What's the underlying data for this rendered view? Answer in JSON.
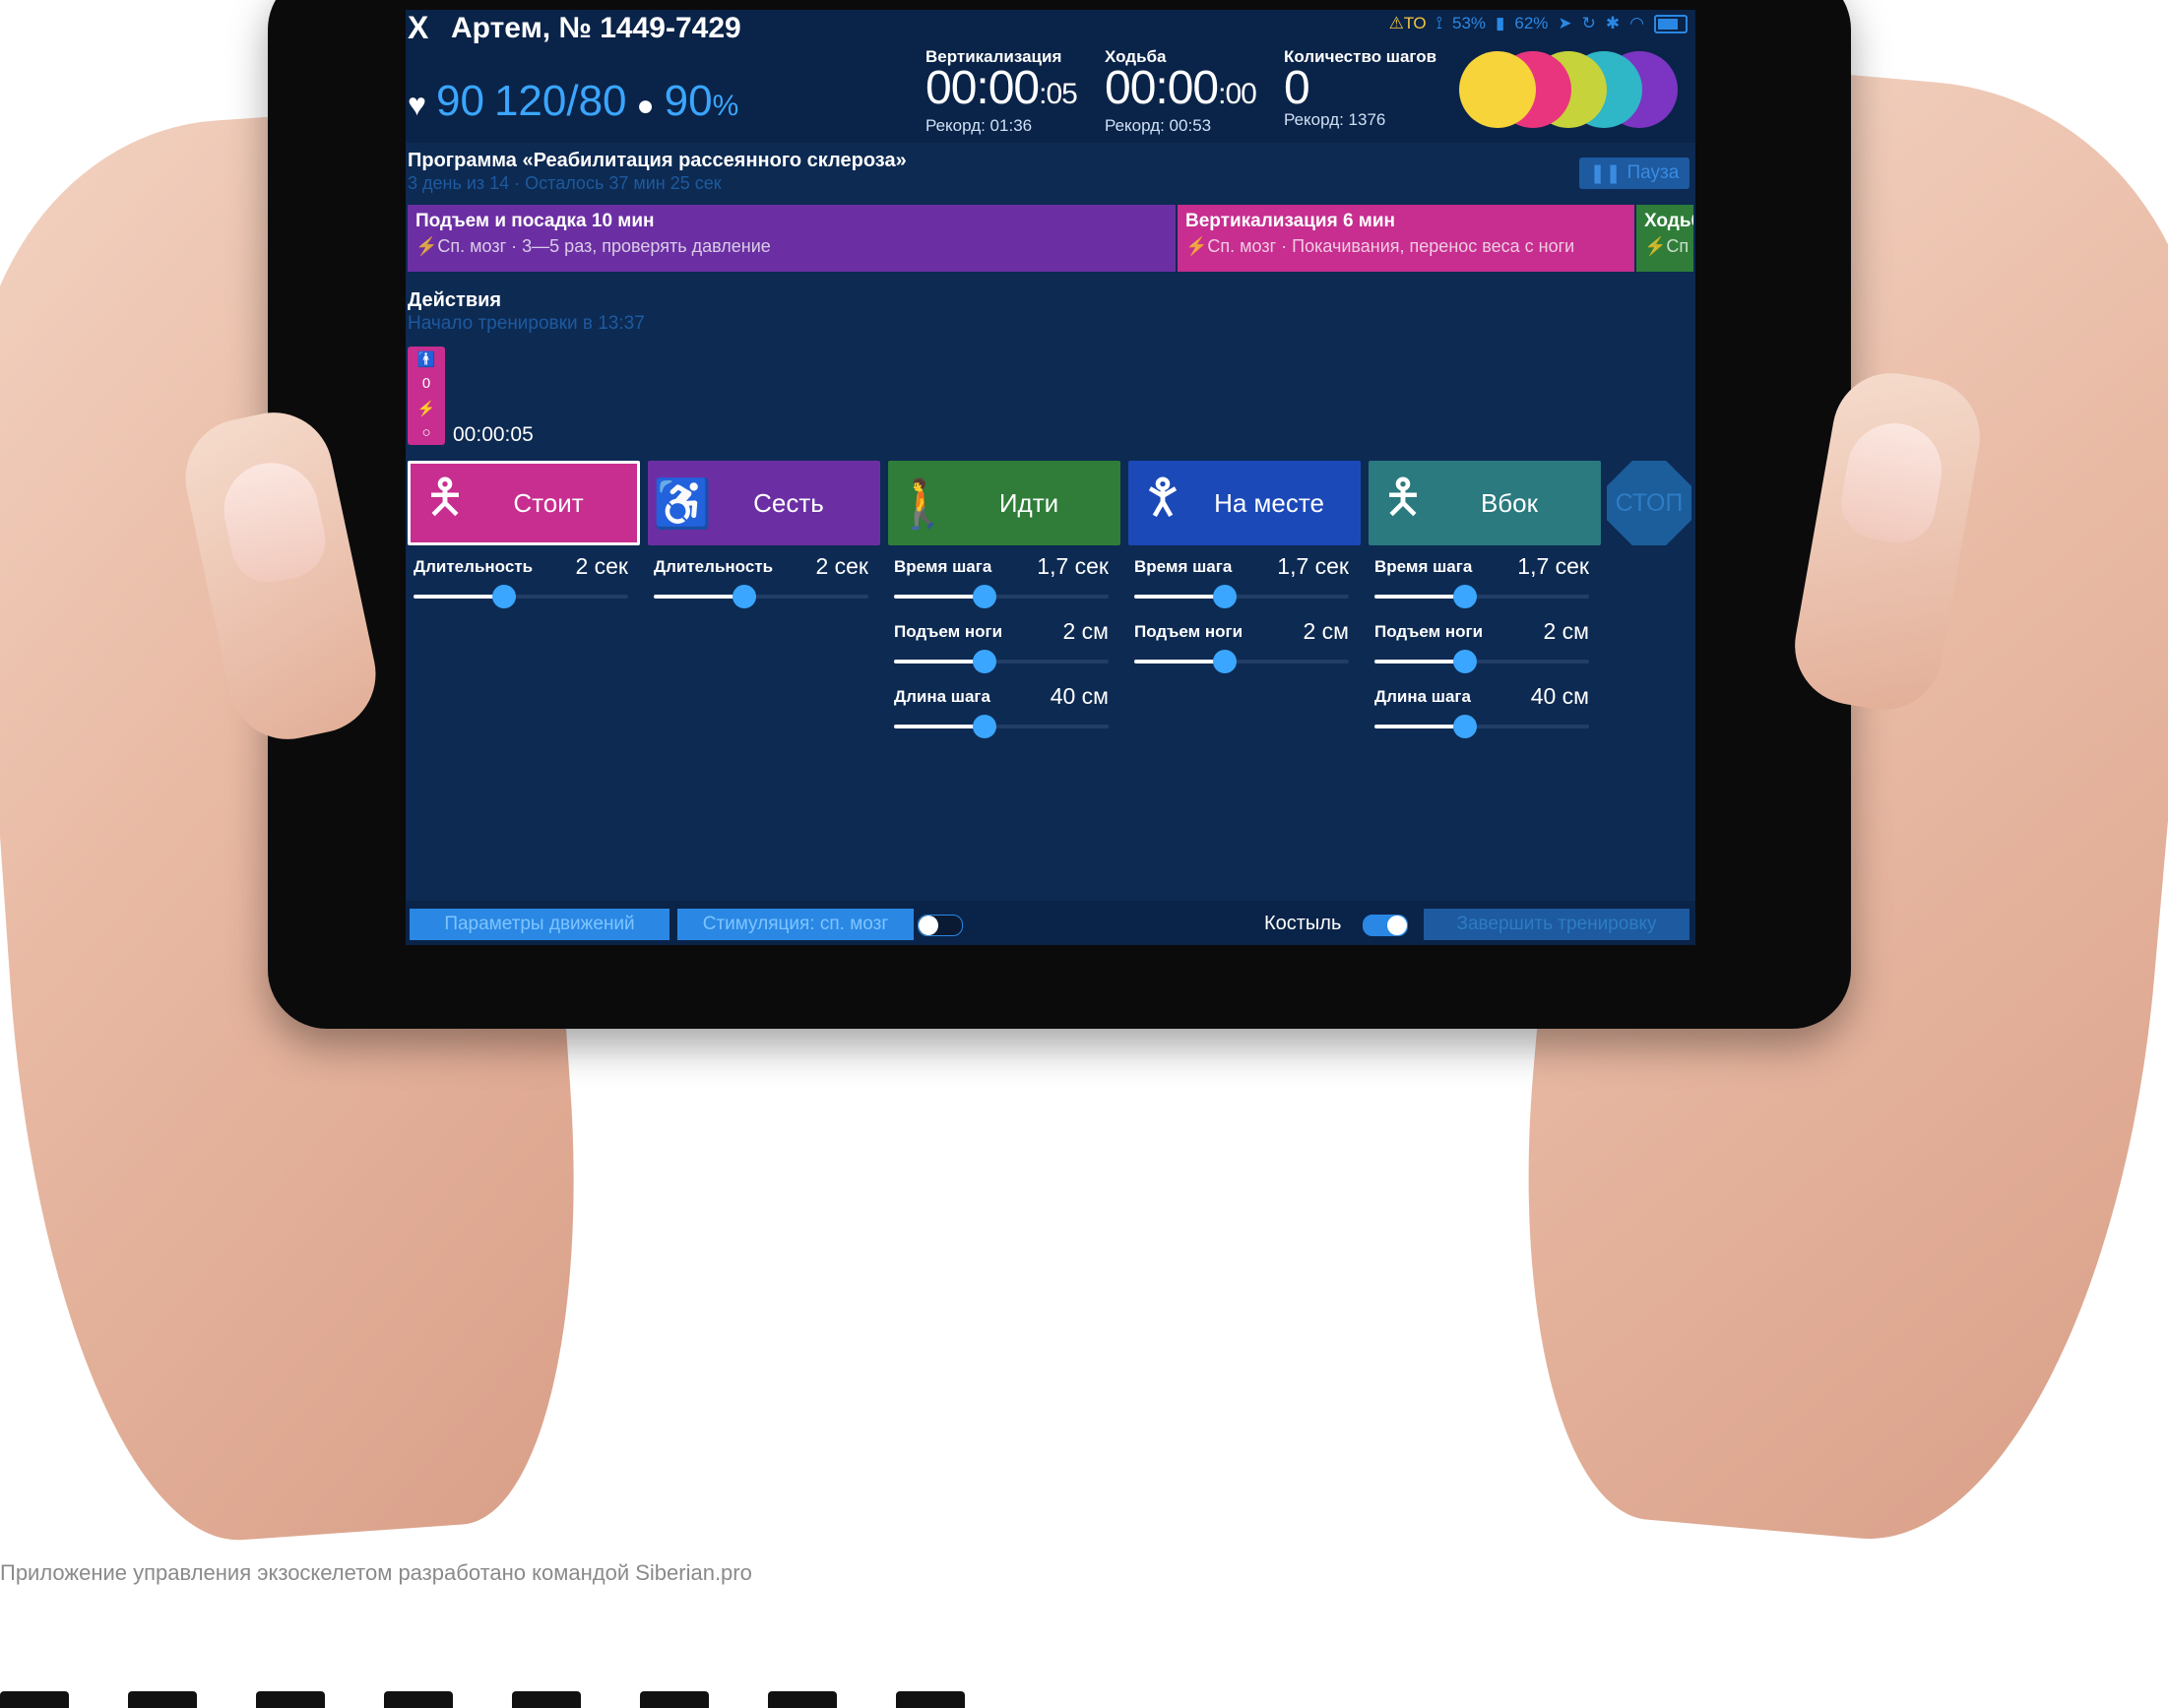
{
  "app": {
    "close_label": "X",
    "patient": "Артем, № 1449-7429",
    "status": {
      "warning": "⚠ТО",
      "crutch_battery": "53%",
      "exo_battery": "62%",
      "icons": [
        "location-icon",
        "sync-icon",
        "bluetooth-icon",
        "wifi-icon",
        "battery-icon"
      ]
    },
    "vitals": {
      "pulse": "90",
      "pressure": "120/80",
      "saturation": "90",
      "saturation_unit": "%"
    },
    "metrics": {
      "verticalization": {
        "label": "Вертикализация",
        "value": "00:00",
        "value_small": ":05",
        "record": "Рекорд: 01:36"
      },
      "walking": {
        "label": "Ходьба",
        "value": "00:00",
        "value_small": ":00",
        "record": "Рекорд: 00:53"
      },
      "steps": {
        "label": "Количество шагов",
        "value": "0",
        "record": "Рекорд: 1376"
      }
    },
    "circle_colors": [
      "#f6d43a",
      "#e9357e",
      "#c7d33a",
      "#2fb6c7",
      "#7b35c2"
    ]
  },
  "program": {
    "title": "Программа «Реабилитация рассеянного склероза»",
    "subtitle": "3 день из 14 · Осталось 37 мин 25 сек",
    "pause_label": "Пауза",
    "segments": [
      {
        "title": "Подъем и посадка 10 мин",
        "detail": "⚡Сп. мозг · 3—5 раз, проверять давление",
        "color": "#6b2fa3"
      },
      {
        "title": "Вертикализация 6 мин",
        "detail": "⚡Сп. мозг · Покачивания, перенос веса с ноги",
        "color": "#c72e8f"
      },
      {
        "title": "Ходьба",
        "detail": "⚡Сп",
        "color": "#2f7d39"
      }
    ]
  },
  "actions": {
    "title": "Действия",
    "subtitle": "Начало тренировки в 13:37",
    "marker_count": "0",
    "time": "00:00:05"
  },
  "modes": [
    {
      "label": "Стоит",
      "color": "#c72e8f",
      "icon": "standing-person-icon"
    },
    {
      "label": "Сесть",
      "color": "#6b2fa3",
      "icon": "sitting-person-icon"
    },
    {
      "label": "Идти",
      "color": "#2f7d39",
      "icon": "walking-person-icon"
    },
    {
      "label": "На месте",
      "color": "#1c49b8",
      "icon": "stepping-person-icon"
    },
    {
      "label": "Вбок",
      "color": "#2a7a7f",
      "icon": "side-step-person-icon"
    }
  ],
  "stop_label": "СТОП",
  "params": {
    "duration_label": "Длительность",
    "step_time_label": "Время шага",
    "leg_lift_label": "Подъем ноги",
    "step_length_label": "Длина шага",
    "stand_duration": {
      "value": "2 сек",
      "level": 0.42
    },
    "sit_duration": {
      "value": "2 сек",
      "level": 0.42
    },
    "walk_step_time": {
      "value": "1,7 сек",
      "level": 0.42
    },
    "walk_leg_lift": {
      "value": "2 см",
      "level": 0.42
    },
    "walk_step_length": {
      "value": "40 см",
      "level": 0.42
    },
    "place_step_time": {
      "value": "1,7 сек",
      "level": 0.42
    },
    "place_leg_lift": {
      "value": "2 см",
      "level": 0.42
    },
    "side_step_time": {
      "value": "1,7 сек",
      "level": 0.42
    },
    "side_leg_lift": {
      "value": "2 см",
      "level": 0.42
    },
    "side_step_length": {
      "value": "40 см",
      "level": 0.42
    }
  },
  "bottom": {
    "motion_params": "Параметры движений",
    "stimulation": "Стимуляция: сп. мозг",
    "stimulation_on": false,
    "crutch_label": "Костыль",
    "crutch_on": true,
    "finish": "Завершить тренировку"
  },
  "caption": "Приложение управления экзоскелетом разработано командой Siberian.pro"
}
